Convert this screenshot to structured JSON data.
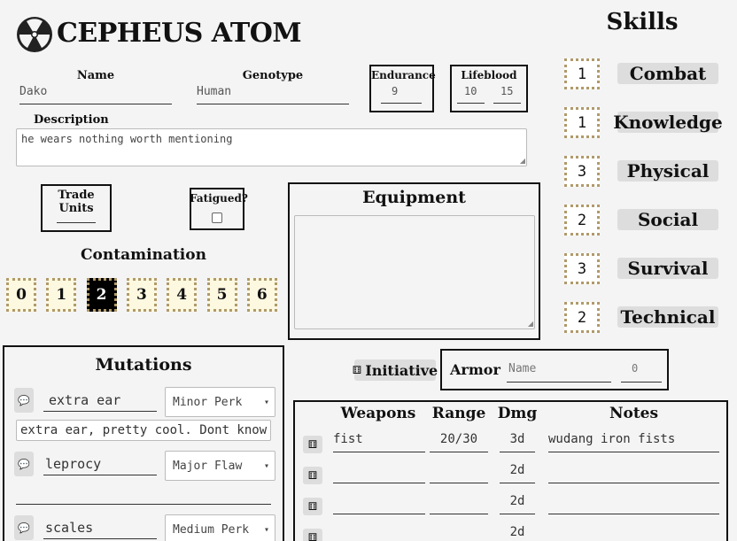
{
  "header": {
    "title": "CEPHEUS ATOM"
  },
  "character": {
    "name_label": "Name",
    "name_value": "Dako",
    "genotype_label": "Genotype",
    "genotype_value": "Human",
    "endurance_label": "Endurance",
    "endurance_value": "9",
    "lifeblood_label": "Lifeblood",
    "lifeblood_current": "10",
    "lifeblood_max": "15",
    "description_label": "Description",
    "description_value": "he wears nothing worth mentioning",
    "trade_units_label": "Trade Units",
    "trade_units_value": "",
    "fatigued_label": "Fatigued?"
  },
  "contamination": {
    "label": "Contamination",
    "levels": [
      "0",
      "1",
      "2",
      "3",
      "4",
      "5",
      "6"
    ],
    "selected": 2
  },
  "equipment": {
    "label": "Equipment",
    "value": ""
  },
  "skills": {
    "title": "Skills",
    "items": [
      {
        "name": "Combat",
        "value": "1"
      },
      {
        "name": "Knowledge",
        "value": "1"
      },
      {
        "name": "Physical",
        "value": "3"
      },
      {
        "name": "Social",
        "value": "2"
      },
      {
        "name": "Survival",
        "value": "3"
      },
      {
        "name": "Technical",
        "value": "2"
      }
    ]
  },
  "mutations": {
    "label": "Mutations",
    "items": [
      {
        "name": "extra ear",
        "type": "Minor Perk",
        "note": "extra ear, pretty cool. Dont know w"
      },
      {
        "name": "leprocy",
        "type": "Major Flaw",
        "note": ""
      },
      {
        "name": "scales",
        "type": "Medium Perk",
        "note": ""
      }
    ]
  },
  "initiative": {
    "label": "Initiative"
  },
  "armor": {
    "label": "Armor",
    "name_placeholder": "Name",
    "value": "0"
  },
  "weapons": {
    "headers": {
      "weapons": "Weapons",
      "range": "Range",
      "dmg": "Dmg",
      "notes": "Notes"
    },
    "rows": [
      {
        "name": "fist",
        "range": "20/30",
        "dmg": "3d",
        "notes": "wudang iron fists"
      },
      {
        "name": "",
        "range": "",
        "dmg": "2d",
        "notes": ""
      },
      {
        "name": "",
        "range": "",
        "dmg": "2d",
        "notes": ""
      },
      {
        "name": "",
        "range": "",
        "dmg": "2d",
        "notes": ""
      }
    ]
  },
  "icons": {
    "logo": "radiation-icon",
    "dice": "dice-icon",
    "chat": "speech-bubble-icon"
  }
}
